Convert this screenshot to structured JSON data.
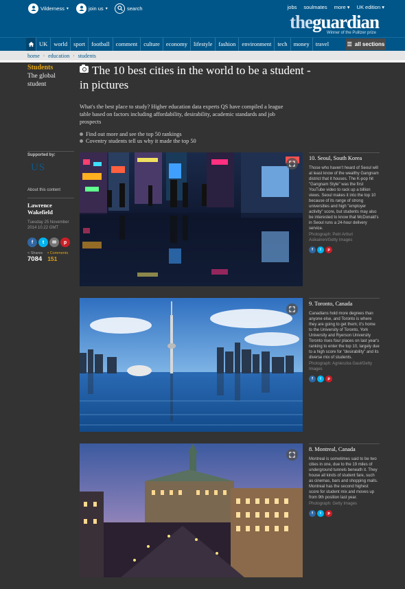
{
  "header": {
    "user_label": "Vilderness",
    "join_label": "join us",
    "search_label": "search",
    "top_links": [
      "jobs",
      "soulmates",
      "more",
      "UK edition"
    ],
    "logo_the": "the",
    "logo_guardian": "guardian",
    "tagline": "Winner of the Pulitzer prize"
  },
  "nav": {
    "items": [
      "UK",
      "world",
      "sport",
      "football",
      "comment",
      "culture",
      "economy",
      "lifestyle",
      "fashion",
      "environment",
      "tech",
      "money",
      "travel"
    ],
    "all_sections": "all sections"
  },
  "breadcrumb": [
    "home",
    "education",
    "students"
  ],
  "section": {
    "name": "Students",
    "subtitle": "The global student"
  },
  "article": {
    "title": "The 10 best cities in the world to be a student - in pictures",
    "standfirst": "What's the best place to study? Higher education data experts QS have compiled a league table based on factors including affordability, desirability, academic standards and job prospects",
    "links": [
      "Find out more and see the top 50 rankings",
      "Coventry students tell us why it made the top 50"
    ]
  },
  "sidebar": {
    "supported_by": "Supported by:",
    "sponsor_logo_text": "US",
    "about": "About this content",
    "author": "Lawrence Wakefield",
    "date": "Tuesday 25 November 2014 10.22 GMT",
    "shares_label": "Shares",
    "shares_count": "7084",
    "comments_label": "Comments",
    "comments_count": "151"
  },
  "slides": [
    {
      "title": "10. Seoul, South Korea",
      "text": "Those who haven't heard of Seoul will at least know of the wealthy Gangnam district that it houses. The K-pop hit \"Gangnam Style\" was the first YouTube video to rack up a billion views. Seoul makes it into the top 10 because of its range of strong universities and high \"employer activity\" score, but students may also be interested to know that McDonald's in Seoul runs a 24-hour delivery service.",
      "credit": "Photograph: Petri Artturi Asikainen/Getty Images"
    },
    {
      "title": "9. Toronto, Canada",
      "text": "Canadians hold more degrees than anyone else, and Toronto is where they are going to get them; it's home to the University of Toronto, York University and Ryerson University Toronto rises four places on last year's ranking to enter the top 10, largely due to a high score for \"desirability\" and its diverse mix of students.",
      "credit": "Photograph: Agnieszka Gaul/Getty Images"
    },
    {
      "title": "8. Montreal, Canada",
      "text": "Montreal is sometimes said to be two cities in one, due to the 19 miles of underground tunnels beneath it. They house all kinds of student fare, such as cinemas, bars and shopping malls. Montreal has the second highest score for student mix and moves up from 9th position last year.",
      "credit": "Photograph: Getty Images"
    }
  ],
  "icons": {
    "facebook": "f",
    "twitter": "t",
    "email": "✉",
    "pinterest": "p"
  }
}
